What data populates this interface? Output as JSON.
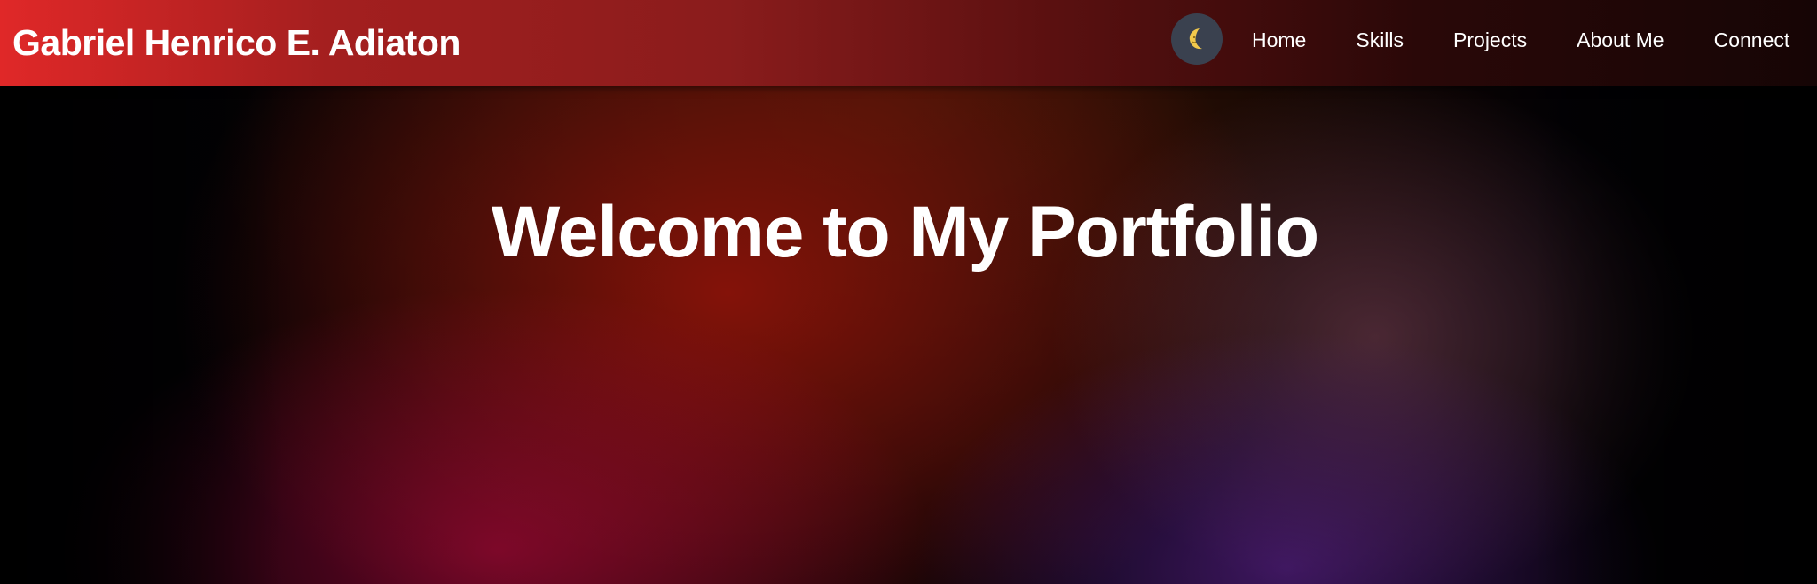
{
  "navbar": {
    "brand": "Gabriel Henrico E. Adiaton",
    "theme_toggle_icon": "crescent-moon-icon",
    "links": [
      {
        "label": "Home"
      },
      {
        "label": "Skills"
      },
      {
        "label": "Projects"
      },
      {
        "label": "About Me"
      },
      {
        "label": "Connect"
      }
    ]
  },
  "hero": {
    "title": "Welcome to My Portfolio"
  },
  "colors": {
    "navbar_start": "#e02828",
    "navbar_end": "#160505",
    "toggle_bg": "#3a414f",
    "moon": "#f2c94c",
    "text": "#ffffff"
  }
}
